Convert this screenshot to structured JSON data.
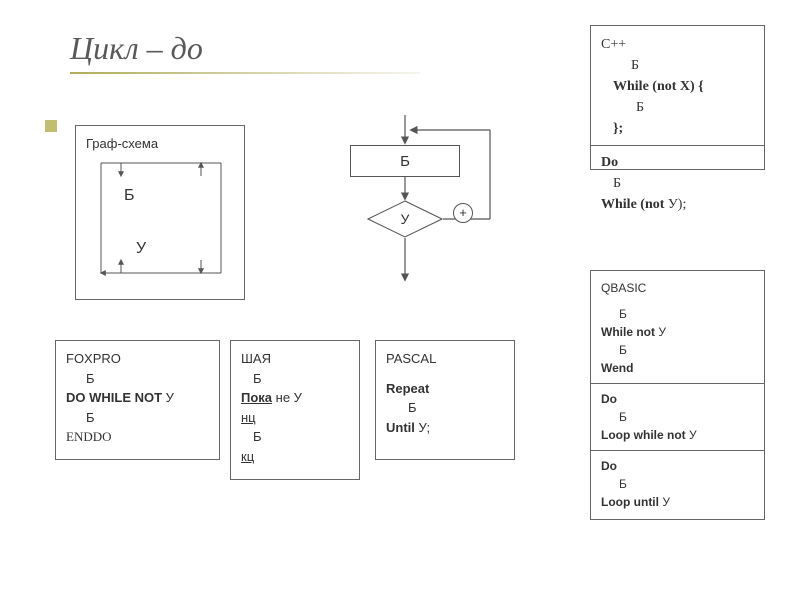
{
  "title": "Цикл – до",
  "graf": {
    "title": "Граф-схема",
    "b": "Б",
    "u": "У"
  },
  "flow": {
    "block": "Б",
    "cond": "У",
    "plus": "+"
  },
  "foxpro": {
    "name": "FOXPRO",
    "l1": "Б",
    "l2a": "DO WHILE  NOT ",
    "l2b": "У",
    "l3": "Б",
    "l4": "ENDDO"
  },
  "shaya": {
    "name": "ШАЯ",
    "l1": "Б",
    "l2a": "Пока",
    "l2b": "  не ",
    "l2c": "У",
    "l3": "нц",
    "l4": "Б",
    "l5": "кц"
  },
  "pascal": {
    "name": "PASCAL",
    "l1": "Repeat",
    "l2": "Б",
    "l3a": "Until ",
    "l3b": "У;"
  },
  "cpp": {
    "name": "С++",
    "a1": "Б",
    "a2": "While (not X) {",
    "a3": "Б",
    "a4": "};",
    "b1": "Do",
    "b2": "Б",
    "b3a": "While (not ",
    "b3b": "У);"
  },
  "qbasic": {
    "name": "QBASIC",
    "a1": "Б",
    "a2a": "While not ",
    "a2b": "У",
    "a3": "Б",
    "a4": "Wend",
    "b1": "Do",
    "b2": "Б",
    "b3a": "Loop while not  ",
    "b3b": "У",
    "c1": "Do",
    "c2": "Б",
    "c3a": "Loop until  ",
    "c3b": "У"
  }
}
